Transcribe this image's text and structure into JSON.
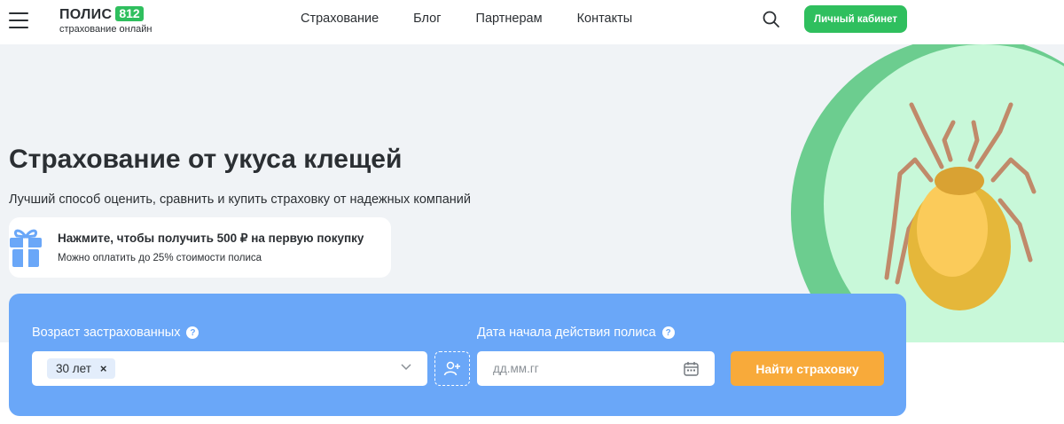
{
  "header": {
    "logo_title": "ПОЛИС",
    "logo_badge": "812",
    "logo_subtitle": "страхование онлайн",
    "nav": [
      {
        "label": "Страхование"
      },
      {
        "label": "Блог"
      },
      {
        "label": "Партнерам"
      },
      {
        "label": "Контакты"
      }
    ],
    "cabinet_label": "Личный кабинет"
  },
  "hero": {
    "title": "Страхование от укуса клещей",
    "subtitle": "Лучший способ оценить, сравнить и купить страховку от надежных компаний"
  },
  "promo": {
    "title": "Нажмите, чтобы получить 500 ₽ на первую покупку",
    "subtitle": "Можно оплатить до 25% стоимости полиса"
  },
  "form": {
    "age_label": "Возраст застрахованных",
    "age_chip": "30 лет",
    "age_chip_remove": "×",
    "help_mark": "?",
    "date_label": "Дата начала действия полиса",
    "date_placeholder": "дд.мм.гг",
    "submit_label": "Найти страховку"
  },
  "colors": {
    "brand_green": "#2fbf5e",
    "form_blue": "#6aa7f8",
    "accent_orange": "#f8aa3a",
    "hero_bg": "#f0f3f6",
    "circle_outer": "#6ccd8f",
    "circle_inner": "#c8f8d9"
  },
  "icons": [
    "menu-icon",
    "search-icon",
    "gift-icon",
    "question-icon",
    "chevron-down-icon",
    "add-person-icon",
    "calendar-icon",
    "tick-illustration"
  ]
}
